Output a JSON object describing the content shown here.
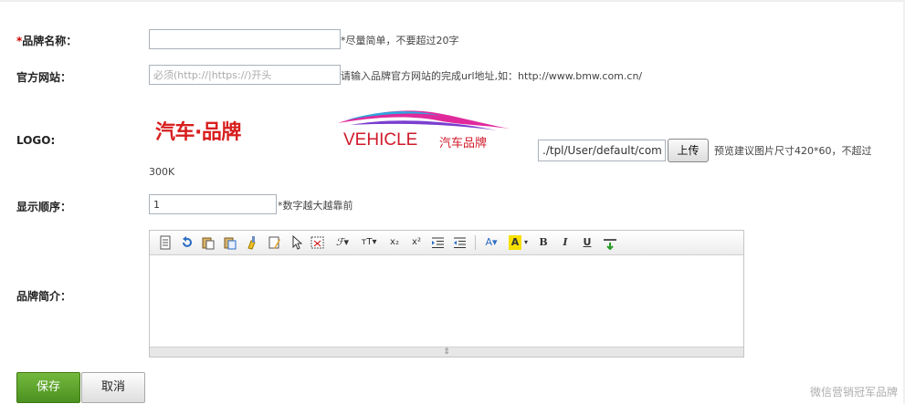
{
  "form": {
    "brand_name": {
      "required_mark": "*",
      "label": "品牌名称：",
      "value": "",
      "hint": "*尽量简单，不要超过20字"
    },
    "website": {
      "label": "官方网站：",
      "value": "",
      "placeholder": "必须(http://|https://)开头",
      "hint": "请输入品牌官方网站的完成url地址,如：http://www.bmw.com.cn/"
    },
    "logo": {
      "label": "LOGO:",
      "sample_cn": "汽车·品牌",
      "sample_en": "VEHICLE",
      "sample_en_cn": "汽车品牌",
      "path_value": "./tpl/User/default/com",
      "upload_label": "上传",
      "hint": "预览建议图片尺寸420*60，不超过",
      "hint_cont": "300K"
    },
    "order": {
      "label": "显示顺序：",
      "value": "1",
      "hint": "*数字越大越靠前"
    },
    "intro": {
      "label": "品牌简介：",
      "value": ""
    }
  },
  "editor_toolbar": {
    "font_family": "ℱ▾",
    "font_size": "тT▾",
    "subscript": "x₂",
    "superscript": "x²",
    "font_color": "A▾",
    "bg_color": "A",
    "bold": "B",
    "italic": "I",
    "underline": "U",
    "resize_handle": "⇕"
  },
  "colors": {
    "save_green": "#5ca22d",
    "required_red": "#cc0000",
    "logo_red": "#d81e1e"
  },
  "actions": {
    "save_label": "保存",
    "cancel_label": "取消"
  },
  "watermark": "微信营销冠军品牌"
}
